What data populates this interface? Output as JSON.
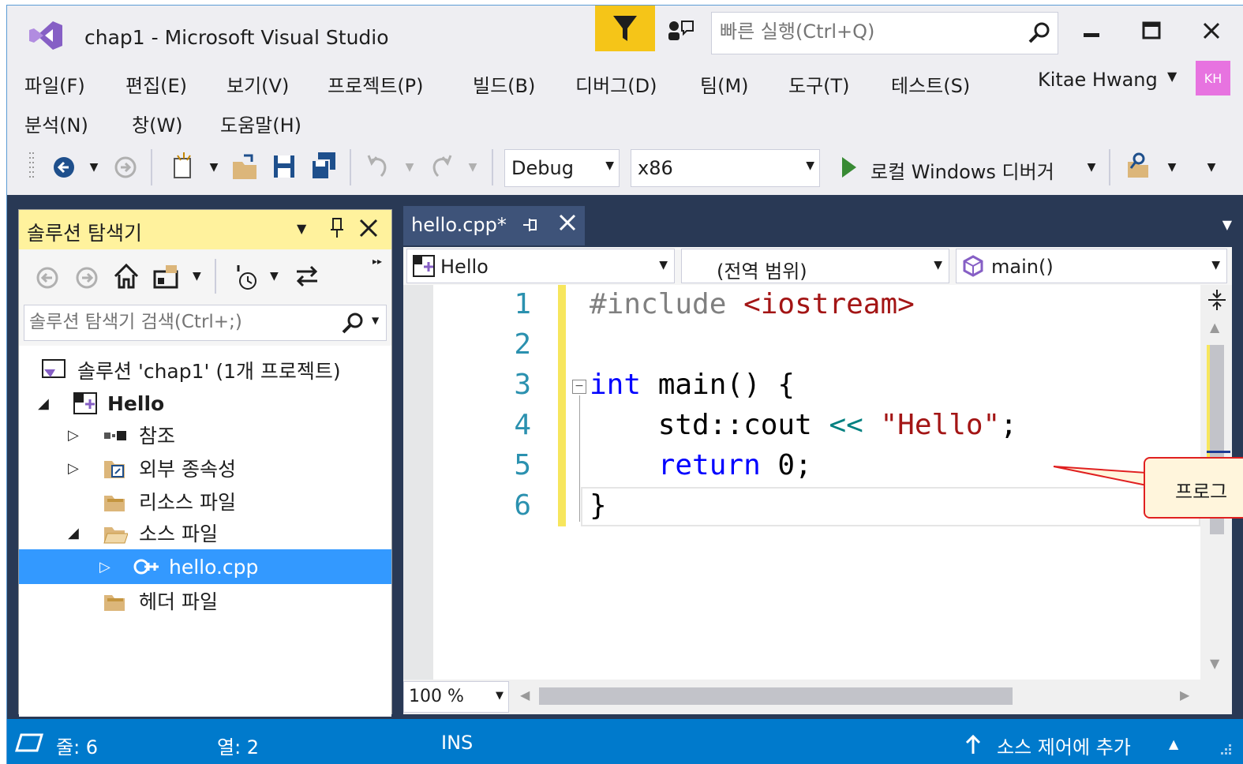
{
  "window": {
    "title": "chap1 - Microsoft Visual Studio",
    "quick_launch_placeholder": "빠른 실행(Ctrl+Q)"
  },
  "menu": {
    "row1": [
      "파일(F)",
      "편집(E)",
      "보기(V)",
      "프로젝트(P)",
      "빌드(B)",
      "디버그(D)",
      "팀(M)",
      "도구(T)",
      "테스트(S)"
    ],
    "row2": [
      "분석(N)",
      "창(W)",
      "도움말(H)"
    ],
    "user_name": "Kitae Hwang",
    "avatar_initials": "KH"
  },
  "toolbar": {
    "configuration": "Debug",
    "platform": "x86",
    "run_label": "로컬 Windows 디버거"
  },
  "solution_explorer": {
    "title": "솔루션 탐색기",
    "search_placeholder": "솔루션 탐색기 검색(Ctrl+;)",
    "solution_label": "솔루션 'chap1' (1개 프로젝트)",
    "project_label": "Hello",
    "references_label": "참조",
    "external_deps_label": "외부 종속성",
    "resource_files_label": "리소스 파일",
    "source_files_label": "소스 파일",
    "source_file_label": "hello.cpp",
    "header_files_label": "헤더 파일"
  },
  "editor": {
    "tab_label": "hello.cpp*",
    "nav_project": "Hello",
    "nav_scope": "(전역 범위)",
    "nav_member": "main()",
    "line_numbers": [
      "1",
      "2",
      "3",
      "4",
      "5",
      "6"
    ],
    "code": {
      "l1_directive": "#include",
      "l1_header": "<iostream>",
      "l3_kw": "int",
      "l3_rest": " main() {",
      "l4_cout": "std::cout ",
      "l4_op": "<<",
      "l4_str": "\"Hello\"",
      "l4_end": ";",
      "l5_kw": "return",
      "l5_rest": " 0;",
      "l6": "}"
    },
    "zoom": "100 %"
  },
  "callout": {
    "text": "프로그"
  },
  "status_bar": {
    "line": "줄: 6",
    "column": "열: 2",
    "mode": "INS",
    "source_control": "소스 제어에 추가"
  },
  "colors": {
    "accent": "#007acc",
    "workspace": "#293955",
    "selection": "#3399ff",
    "active_tool_window": "#fff29d"
  }
}
